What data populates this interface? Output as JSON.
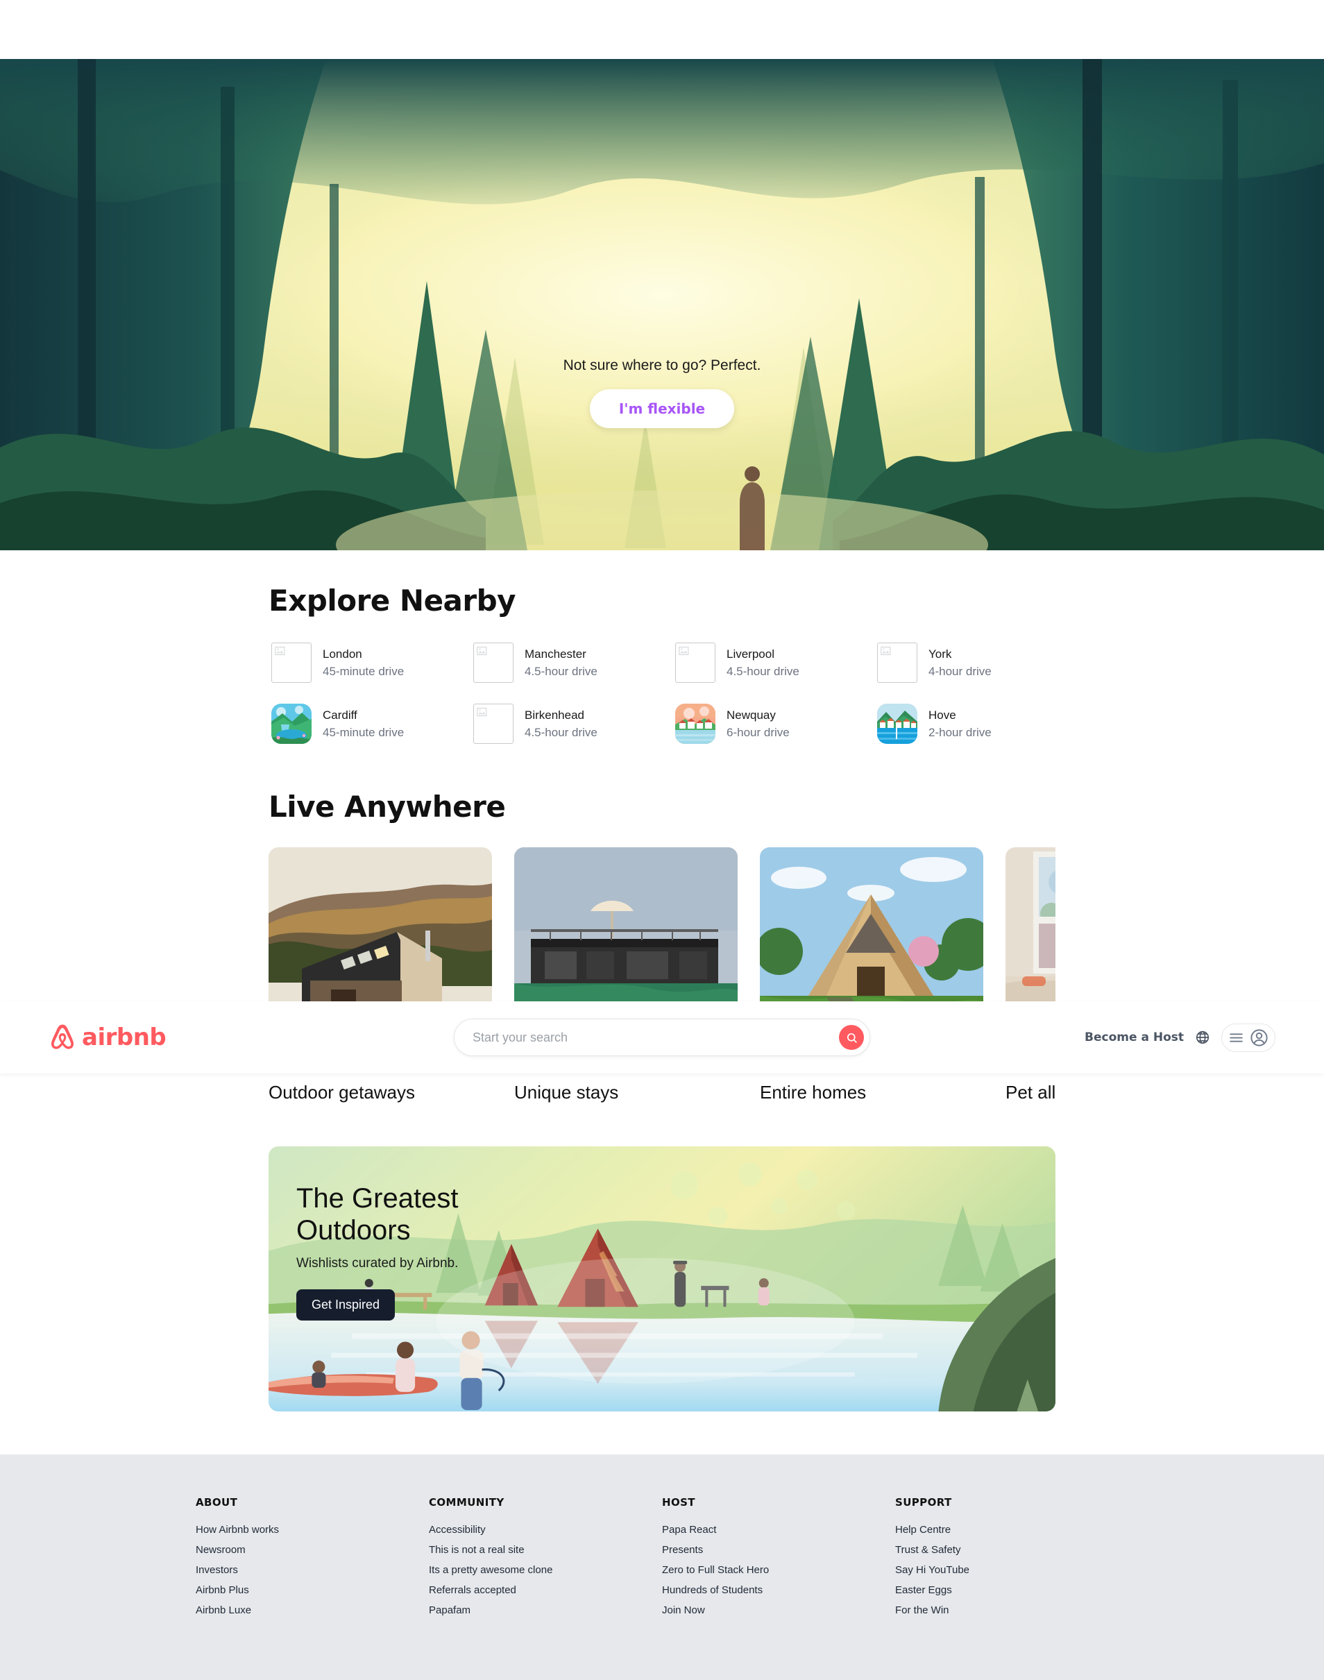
{
  "header": {
    "logo_text": "airbnb",
    "search": {
      "placeholder": "Start your search",
      "value": ""
    },
    "become_host_label": "Become a Host"
  },
  "hero": {
    "tagline": "Not sure where to go? Perfect.",
    "button_label": "I'm flexible"
  },
  "explore": {
    "title": "Explore Nearby",
    "items": [
      {
        "name": "London",
        "distance": "45-minute drive",
        "image": "broken"
      },
      {
        "name": "Manchester",
        "distance": "4.5-hour drive",
        "image": "broken"
      },
      {
        "name": "Liverpool",
        "distance": "4.5-hour drive",
        "image": "broken"
      },
      {
        "name": "York",
        "distance": "4-hour drive",
        "image": "broken"
      },
      {
        "name": "Cardiff",
        "distance": "45-minute drive",
        "image": "valley-lake"
      },
      {
        "name": "Birkenhead",
        "distance": "4.5-hour drive",
        "image": "broken"
      },
      {
        "name": "Newquay",
        "distance": "6-hour drive",
        "image": "coastal-village"
      },
      {
        "name": "Hove",
        "distance": "2-hour drive",
        "image": "harbour-town"
      }
    ]
  },
  "live_anywhere": {
    "title": "Live Anywhere",
    "cards": [
      {
        "label": "Outdoor getaways",
        "image": "cabin-hillside"
      },
      {
        "label": "Unique stays",
        "image": "rooftop-terrace"
      },
      {
        "label": "Entire homes",
        "image": "a-frame-house"
      },
      {
        "label": "Pet allowed",
        "image": "bedroom-window"
      }
    ]
  },
  "banner": {
    "title": "The Greatest Outdoors",
    "subtitle": "Wishlists curated by Airbnb.",
    "button_label": "Get Inspired"
  },
  "footer": {
    "columns": [
      {
        "heading": "ABOUT",
        "links": [
          "How Airbnb works",
          "Newsroom",
          "Investors",
          "Airbnb Plus",
          "Airbnb Luxe"
        ]
      },
      {
        "heading": "COMMUNITY",
        "links": [
          "Accessibility",
          "This is not a real site",
          "Its a pretty awesome clone",
          "Referrals accepted",
          "Papafam"
        ]
      },
      {
        "heading": "HOST",
        "links": [
          "Papa React",
          "Presents",
          "Zero to Full Stack Hero",
          "Hundreds of Students",
          "Join Now"
        ]
      },
      {
        "heading": "SUPPORT",
        "links": [
          "Help Centre",
          "Trust & Safety",
          "Say Hi YouTube",
          "Easter Eggs",
          "For the Win"
        ]
      }
    ]
  },
  "colors": {
    "brand": "#FF5A5F",
    "hero_button_text": "#A855F7",
    "banner_button_bg": "#161E2E",
    "footer_bg": "#e6e8eb",
    "muted_text": "#6b7280"
  },
  "icons": {
    "search": "search-icon",
    "globe": "globe-icon",
    "menu": "menu-icon",
    "user": "user-avatar-icon",
    "broken_image": "broken-image-icon"
  }
}
